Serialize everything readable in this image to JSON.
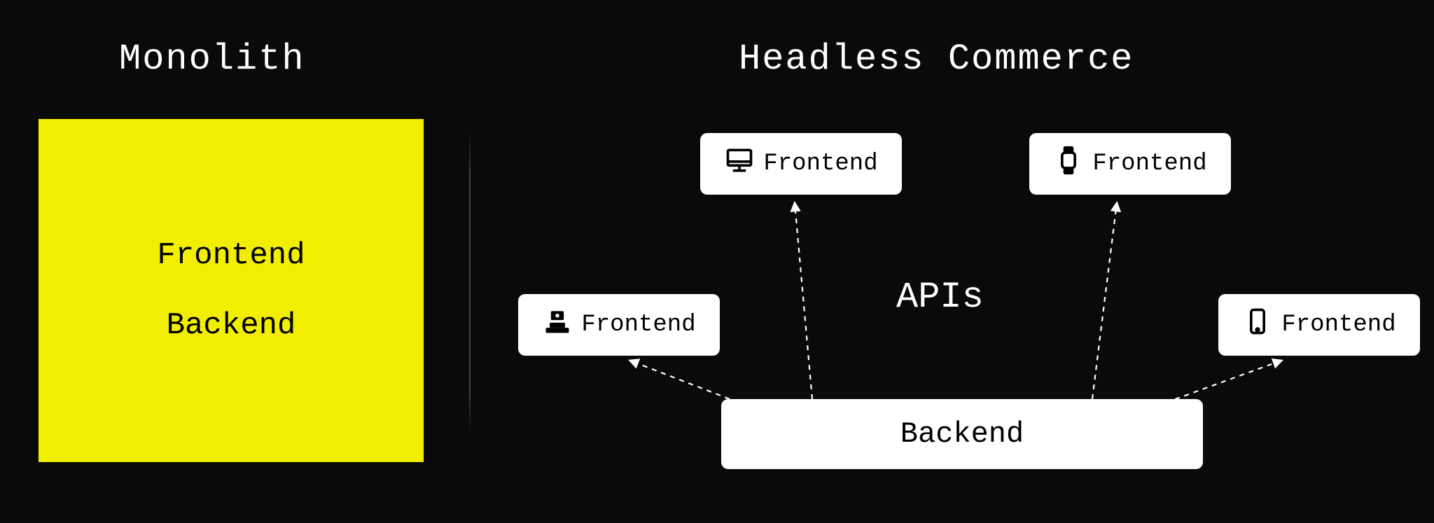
{
  "left": {
    "title": "Monolith",
    "frontend": "Frontend",
    "backend": "Backend"
  },
  "right": {
    "title": "Headless Commerce",
    "apis_label": "APIs",
    "backend": "Backend",
    "frontends": [
      {
        "icon": "pos-icon",
        "label": "Frontend"
      },
      {
        "icon": "desktop-icon",
        "label": "Frontend"
      },
      {
        "icon": "watch-icon",
        "label": "Frontend"
      },
      {
        "icon": "phone-icon",
        "label": "Frontend"
      }
    ]
  }
}
